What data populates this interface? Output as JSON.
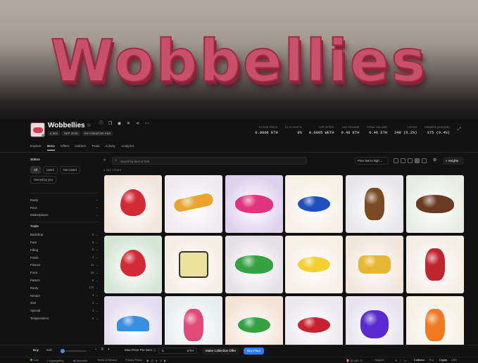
{
  "banner": {
    "text": "Wobbellies"
  },
  "collection": {
    "name": "Wobbellies",
    "badges": [
      "4,000",
      "SEP 2026",
      "5% CREATOR FEE"
    ]
  },
  "stats": [
    {
      "label": "FLOOR PRICE",
      "value": "0.0006 ETH"
    },
    {
      "label": "1D FLOOR %",
      "value": "0%"
    },
    {
      "label": "TOP OFFER",
      "value": "0.0005 WETH"
    },
    {
      "label": "24H VOLUME",
      "value": "0.46 ETH"
    },
    {
      "label": "TOTAL VOLUME",
      "value": "0.46 ETH"
    },
    {
      "label": "LISTED",
      "value": "248 (6.2%)"
    },
    {
      "label": "OWNERS (UNIQUE)",
      "value": "375 (9.4%)"
    }
  ],
  "tabs": [
    "Explore",
    "Items",
    "Offers",
    "Holders",
    "Traits",
    "Activity",
    "Analytics"
  ],
  "sidebar": {
    "status_title": "Status",
    "status_chips": [
      "All",
      "Listed",
      "Not Listed",
      "Owned by you"
    ],
    "filters": [
      "Rarity",
      "Price",
      "Marketplaces"
    ],
    "traits_title": "Traits",
    "traits": [
      {
        "name": "Backdrop",
        "count": "5"
      },
      {
        "name": "Face",
        "count": "5"
      },
      {
        "name": "Filling",
        "count": "8"
      },
      {
        "name": "Finish",
        "count": "4"
      },
      {
        "name": "Flavour",
        "count": "11"
      },
      {
        "name": "Form",
        "count": "16"
      },
      {
        "name": "Pattern",
        "count": "5"
      },
      {
        "name": "Rarity",
        "count": "176"
      },
      {
        "name": "Render",
        "count": "3"
      },
      {
        "name": "Size",
        "count": "3"
      },
      {
        "name": "Special",
        "count": "4"
      },
      {
        "name": "Temperament",
        "count": "5"
      }
    ]
  },
  "toolbar": {
    "search_placeholder": "Search by item or trait",
    "sort": "Price low to high",
    "insights": "Insights",
    "item_count": "4,000 ITEMS"
  },
  "items": [
    {
      "bg": "#f1e6dc",
      "color": "#d42a35",
      "shape": "drop"
    },
    {
      "bg": "#eeeaf0",
      "color": "#e9a52e",
      "shape": "worm"
    },
    {
      "bg": "#ddd2ee",
      "color": "#e0357e",
      "shape": "cloud"
    },
    {
      "bg": "#f5efe4",
      "color": "#1f4ec0",
      "shape": "bean"
    },
    {
      "bg": "#e8e6ea",
      "color": "#7a4a22",
      "shape": "bear"
    },
    {
      "bg": "#e7ede4",
      "color": "#6a3a22",
      "shape": "cloud"
    },
    {
      "bg": "#d6e6d6",
      "color": "#d42a35",
      "shape": "drop"
    },
    {
      "bg": "#f4eee4",
      "color": "#e8e29a",
      "shape": "block"
    },
    {
      "bg": "#e5e2e6",
      "color": "#34a142",
      "shape": "cloud"
    },
    {
      "bg": "#f5efe4",
      "color": "#f0d130",
      "shape": "bean"
    },
    {
      "bg": "#f1e6dc",
      "color": "#e6b730",
      "shape": "pill"
    },
    {
      "bg": "#f4ede4",
      "color": "#c0242f",
      "shape": "bear"
    },
    {
      "bg": "#e3ddf0",
      "color": "#3a8ee0",
      "shape": "arc"
    },
    {
      "bg": "#e8eef0",
      "color": "#e04a7a",
      "shape": "bear"
    },
    {
      "bg": "#f3e3d6",
      "color": "#34a142",
      "shape": "bean"
    },
    {
      "bg": "#ece8ee",
      "color": "#c8202e",
      "shape": "bean"
    },
    {
      "bg": "#e6e3ec",
      "color": "#5a2ad0",
      "shape": "flower"
    },
    {
      "bg": "#f5efe4",
      "color": "#f07a22",
      "shape": "bear"
    }
  ],
  "bottom": {
    "buy": "Buy",
    "sell": "Sell",
    "qty": "0",
    "max_price_label": "Max Price Per Item",
    "price_value": "0",
    "price_unit": "ETH",
    "offer_button": "Make Collection Offer",
    "buy_button": "Buy Floor"
  },
  "footer": {
    "live": "Live",
    "aggregating": "Aggregating",
    "networks": "Networks",
    "terms": "Terms of Service",
    "privacy": "Privacy Policy",
    "gas": "$2,490.70",
    "support": "Support",
    "collector": "Collector",
    "pro": "Pro",
    "crypto": "Crypto",
    "usd": "USD"
  }
}
